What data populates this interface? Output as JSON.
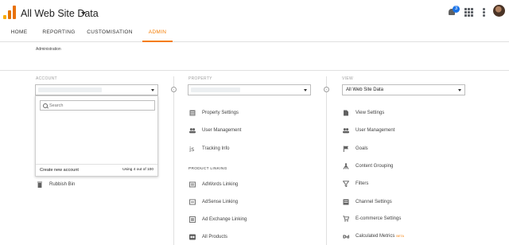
{
  "header": {
    "view_title": "All Web Site Data",
    "notification_count": "3"
  },
  "nav": {
    "tabs": [
      {
        "label": "HOME"
      },
      {
        "label": "REPORTING"
      },
      {
        "label": "CUSTOMISATION"
      },
      {
        "label": "ADMIN"
      }
    ],
    "active_tab": "ADMIN"
  },
  "page": {
    "breadcrumb": "Administration"
  },
  "account": {
    "label": "ACCOUNT",
    "search_placeholder": "Search",
    "create_label": "Create new account",
    "usage": "Using 4 out of 100",
    "items": [
      {
        "label": "Rubbish Bin",
        "icon": "trash-icon"
      }
    ]
  },
  "property": {
    "label": "PROPERTY",
    "items": [
      {
        "label": "Property Settings",
        "icon": "settings-icon"
      },
      {
        "label": "User Management",
        "icon": "users-icon"
      },
      {
        "label": "Tracking Info",
        "icon": "tracking-icon"
      }
    ],
    "section": "PRODUCT LINKING",
    "linking": [
      {
        "label": "AdWords Linking",
        "icon": "adwords-icon"
      },
      {
        "label": "AdSense Linking",
        "icon": "adsense-icon"
      },
      {
        "label": "Ad Exchange Linking",
        "icon": "adexchange-icon"
      },
      {
        "label": "All Products",
        "icon": "all-products-icon"
      }
    ]
  },
  "view": {
    "label": "VIEW",
    "selected": "All Web Site Data",
    "items": [
      {
        "label": "View Settings",
        "icon": "document-icon"
      },
      {
        "label": "User Management",
        "icon": "users-icon"
      },
      {
        "label": "Goals",
        "icon": "flag-icon"
      },
      {
        "label": "Content Grouping",
        "icon": "content-grouping-icon"
      },
      {
        "label": "Filters",
        "icon": "filter-icon"
      },
      {
        "label": "Channel Settings",
        "icon": "channel-icon"
      },
      {
        "label": "E-commerce Settings",
        "icon": "cart-icon"
      },
      {
        "label": "Calculated Metrics",
        "icon": "dd-icon",
        "badge": "BETA"
      }
    ]
  },
  "colors": {
    "accent": "#f57c00",
    "notification": "#1a73e8"
  }
}
